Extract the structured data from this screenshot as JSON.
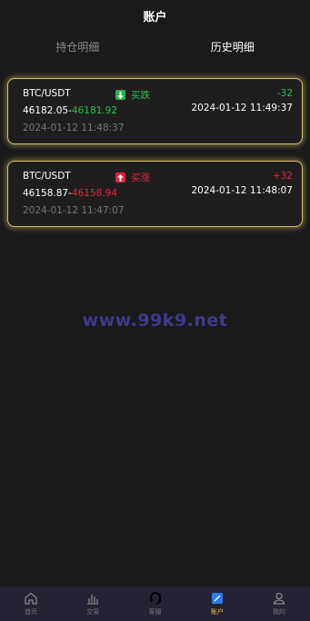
{
  "header": {
    "title": "账户"
  },
  "tabs": [
    {
      "label": "持仓明细",
      "active": false
    },
    {
      "label": "历史明细",
      "active": true
    }
  ],
  "trades": [
    {
      "pair": "BTC/USDT",
      "direction_label": "买跌",
      "direction": "down",
      "change": "-32",
      "open_price": "46182.05",
      "separator": "-",
      "close_price": "46181.92",
      "close_time": "2024-01-12 11:49:37",
      "open_time": "2024-01-12 11:48:37"
    },
    {
      "pair": "BTC/USDT",
      "direction_label": "买涨",
      "direction": "up",
      "change": "+32",
      "open_price": "46158.87",
      "separator": "-",
      "close_price": "46158.94",
      "close_time": "2024-01-12 11:48:07",
      "open_time": "2024-01-12 11:47:07"
    }
  ],
  "watermark": "www.99k9.net",
  "bottom_nav": [
    {
      "label": "首页",
      "icon": "home-icon",
      "active": false
    },
    {
      "label": "交易",
      "icon": "chart-icon",
      "active": false
    },
    {
      "label": "客服",
      "icon": "support-icon",
      "active": false
    },
    {
      "label": "账户",
      "icon": "account-icon",
      "active": true
    },
    {
      "label": "我的",
      "icon": "user-icon",
      "active": false
    }
  ],
  "colors": {
    "background": "#1a1a1a",
    "accent_gold": "#e8c43a",
    "down_green": "#28c04f",
    "up_red": "#e0243a"
  }
}
